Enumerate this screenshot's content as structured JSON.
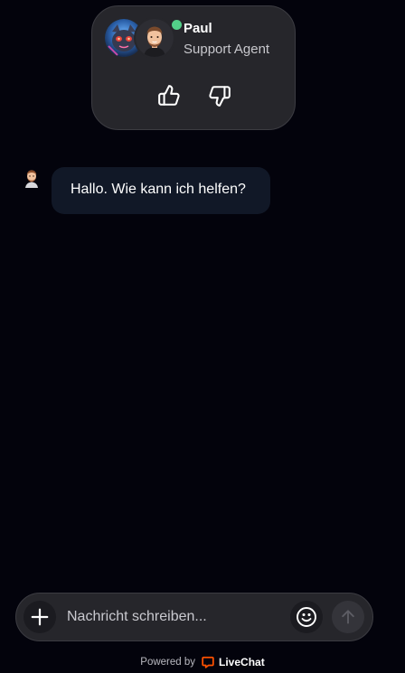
{
  "agent": {
    "name": "Paul",
    "role": "Support Agent",
    "status": "online",
    "status_color": "#53d089",
    "bot_avatar_icon": "bot-avatar-icon",
    "agent_avatar_icon": "agent-avatar-icon"
  },
  "rating": {
    "thumbs_up_icon": "thumbs-up-icon",
    "thumbs_down_icon": "thumbs-down-icon"
  },
  "messages": [
    {
      "sender": "agent",
      "text": "Hallo. Wie kann ich helfen?"
    }
  ],
  "composer": {
    "placeholder": "Nachricht schreiben...",
    "value": "",
    "add_icon": "plus-icon",
    "emoji_icon": "emoji-icon",
    "send_icon": "arrow-up-icon"
  },
  "footer": {
    "powered_by": "Powered by",
    "brand": "LiveChat",
    "brand_color": "#ff5100"
  },
  "colors": {
    "background": "#03030c",
    "card": "#26262b",
    "bubble": "#111827"
  }
}
